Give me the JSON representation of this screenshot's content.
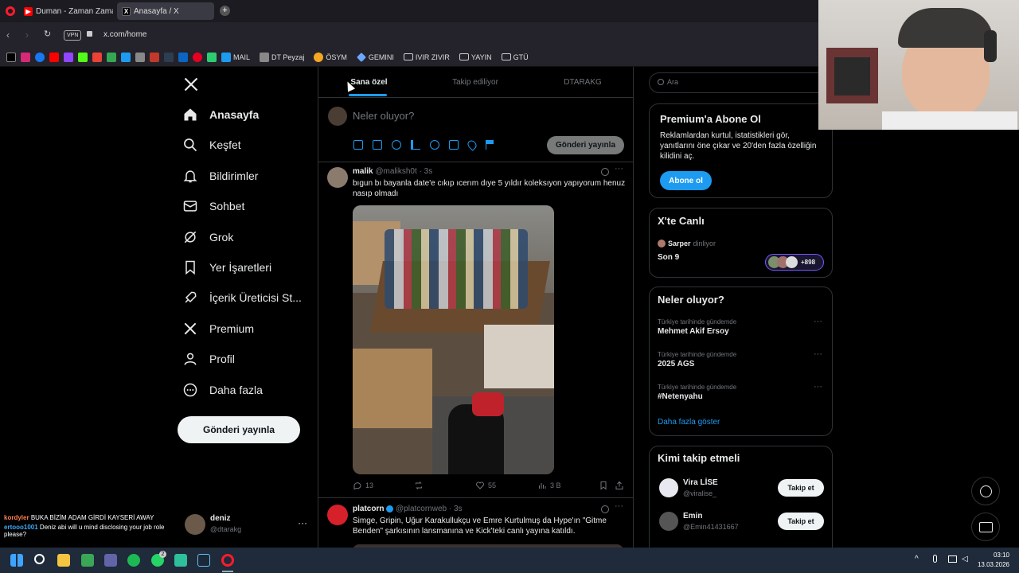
{
  "browser": {
    "tabs": [
      {
        "label": "Duman - Zaman Zaman |"
      },
      {
        "label": "Anasayfa / X"
      }
    ],
    "url": "x.com/home",
    "vpn_label": "VPN",
    "bookmarks": [
      {
        "label": "MAIL",
        "color": "#1d9bf0"
      },
      {
        "label": "DT Peyzaj",
        "color": "#888888"
      },
      {
        "label": "ÖSYM",
        "color": "#f5a623"
      },
      {
        "label": "GEMINI",
        "color": "#6aa9ff"
      },
      {
        "label": "IVIR ZIVIR",
        "color": "#cccccc"
      },
      {
        "label": "YAYIN",
        "color": "#cccccc"
      },
      {
        "label": "GTÜ",
        "color": "#cccccc"
      }
    ]
  },
  "nav": {
    "items": [
      {
        "label": "Anasayfa",
        "icon": "home-icon"
      },
      {
        "label": "Keşfet",
        "icon": "search-icon"
      },
      {
        "label": "Bildirimler",
        "icon": "bell-icon"
      },
      {
        "label": "Sohbet",
        "icon": "mail-icon"
      },
      {
        "label": "Grok",
        "icon": "grok-icon"
      },
      {
        "label": "Yer İşaretleri",
        "icon": "bookmark-icon"
      },
      {
        "label": "İçerik Üreticisi St...",
        "icon": "rocket-icon"
      },
      {
        "label": "Premium",
        "icon": "x-logo-icon"
      },
      {
        "label": "Profil",
        "icon": "person-icon"
      },
      {
        "label": "Daha fazla",
        "icon": "more-circle-icon"
      }
    ],
    "post_button": "Gönderi yayınla"
  },
  "feed": {
    "tabs": [
      "Sana özel",
      "Takip ediliyor",
      "DTARAKG"
    ],
    "composer_placeholder": "Neler oluyor?",
    "composer_button": "Gönderi yayınla",
    "tweets": [
      {
        "name": "malik",
        "handle": "@maliksh0t",
        "time": "· 3s",
        "text": "bıgun bı bayanla date'e cıkıp ıcerım dıye 5 yıldır koleksıyon yapıyorum henuz nasıp olmadı",
        "replies": "13",
        "likes": "55",
        "views": "3 B"
      },
      {
        "name": "platcorn",
        "handle": "@platcornweb",
        "time": "· 3s",
        "text": "Simge, Gripin, Uğur Karakullukçu ve Emre Kurtulmuş da Hype'ın \"Gitme Benden\" şarkısının lansmanına ve Kick'teki canlı yayına katıldı."
      }
    ]
  },
  "sidebar": {
    "search_placeholder": "Ara",
    "premium": {
      "title": "Premium'a Abone Ol",
      "text": "Reklamlardan kurtul, istatistikleri gör, yanıtlarını öne çıkar ve 20'den fazla özelliğin kilidini aç.",
      "button": "Abone ol"
    },
    "live": {
      "title": "X'te Canlı",
      "host": "Sarper",
      "status": "dinliyor",
      "space": "Son 9",
      "count": "+898"
    },
    "trends": {
      "title": "Neler oluyor?",
      "items": [
        {
          "category": "Türkiye tarihinde gündemde",
          "name": "Mehmet Akif Ersoy"
        },
        {
          "category": "Türkiye tarihinde gündemde",
          "name": "2025 AGS"
        },
        {
          "category": "Türkiye tarihinde gündemde",
          "name": "#Netenyahu"
        }
      ],
      "show_more": "Daha fazla göster"
    },
    "who_to_follow": {
      "title": "Kimi takip etmeli",
      "users": [
        {
          "name": "Vira LİSE",
          "handle": "@viralise_",
          "button": "Takip et"
        },
        {
          "name": "Emin",
          "handle": "@Emin41431667",
          "button": "Takip et"
        }
      ]
    }
  },
  "account": {
    "name": "deniz",
    "handle": "@dtarakg"
  },
  "stream_chat": [
    {
      "user": "kordyler",
      "message": "BUKA BİZİM ADAM GİRDİ KAYSERİ AWAY",
      "color": "#ff7f50"
    },
    {
      "user": "ertooo1001",
      "message": "Deniz abi will u mind disclosing your job role please?",
      "color": "#3fa9f5"
    }
  ],
  "taskbar": {
    "time": "03:10",
    "date": "13.03.2026",
    "whatsapp_badge": "2"
  },
  "colors": {
    "accent": "#1d9bf0",
    "background": "#000000",
    "border": "#2f3336",
    "muted": "#71767b"
  }
}
